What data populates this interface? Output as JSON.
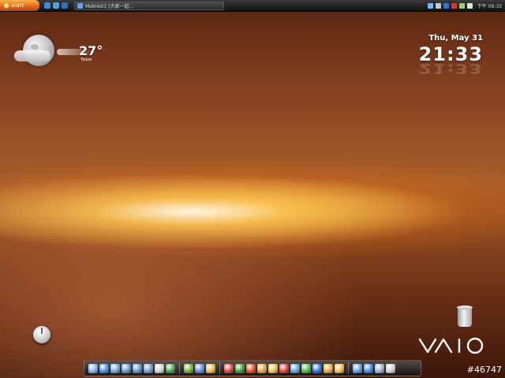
{
  "taskbar": {
    "start_label": "start",
    "task_window_title": "Mobile01 [大家一起...",
    "clock_time": "下午 09:33",
    "quicklaunch_icons": [
      {
        "name": "ie-icon",
        "color": "#3b8be0"
      },
      {
        "name": "show-desktop-icon",
        "color": "#4aa3df"
      },
      {
        "name": "media-icon",
        "color": "#2f6fc4"
      }
    ],
    "tray_icons": [
      {
        "name": "network-icon",
        "color": "#7fb3e6"
      },
      {
        "name": "volume-icon",
        "color": "#c9c9c9"
      },
      {
        "name": "bluetooth-icon",
        "color": "#2f70d6"
      },
      {
        "name": "security-icon",
        "color": "#d23a2a"
      },
      {
        "name": "battery-icon",
        "color": "#9ad06a"
      },
      {
        "name": "ime-icon",
        "color": "#e0e0e0"
      }
    ]
  },
  "weather": {
    "temperature": "27°",
    "city": "Taipei"
  },
  "clock": {
    "date": "Thu, May 31",
    "time": "21:33"
  },
  "dock": {
    "groups": [
      [
        {
          "name": "finder-icon",
          "color": "#7fb0e8"
        },
        {
          "name": "globe-icon",
          "color": "#3e8fd9"
        },
        {
          "name": "folder-icon",
          "color": "#6aa3d8"
        },
        {
          "name": "folder-docs-icon",
          "color": "#5b95cf"
        },
        {
          "name": "folder-music-icon",
          "color": "#5d8fc6"
        },
        {
          "name": "folder-pictures-icon",
          "color": "#6b9ad0"
        },
        {
          "name": "printer-icon",
          "color": "#cfcfcf"
        },
        {
          "name": "spreadsheet-icon",
          "color": "#3fa34d"
        }
      ],
      [
        {
          "name": "tools-icon",
          "color": "#6fae3a"
        },
        {
          "name": "control-panel-icon",
          "color": "#5b8ed6"
        },
        {
          "name": "explorer-icon",
          "color": "#e6b84a"
        }
      ],
      [
        {
          "name": "music-player-icon",
          "color": "#d9423a"
        },
        {
          "name": "video-cut-icon",
          "color": "#3b9b3b"
        },
        {
          "name": "media-center-icon",
          "color": "#e44b1f"
        },
        {
          "name": "vaio-media-icon",
          "color": "#d9a63b"
        },
        {
          "name": "dvd-icon",
          "color": "#e8c14a"
        },
        {
          "name": "messenger-icon",
          "color": "#e04030"
        },
        {
          "name": "equalizer-icon",
          "color": "#5aa0d8"
        },
        {
          "name": "chrome-icon",
          "color": "#4bb84a"
        },
        {
          "name": "bluetooth-icon",
          "color": "#2f6fd6"
        },
        {
          "name": "security-shield-icon",
          "color": "#e0a53b"
        },
        {
          "name": "game-icon",
          "color": "#f0b84a"
        }
      ],
      [
        {
          "name": "network-share-icon",
          "color": "#5d9fe0"
        },
        {
          "name": "internet-icon",
          "color": "#3f86d4"
        },
        {
          "name": "settings-icon",
          "color": "#9ab0c8"
        },
        {
          "name": "recycle-bin-icon",
          "color": "#cfcfcf"
        }
      ]
    ]
  },
  "watermark": "#46747",
  "brand": {
    "vaio_color": "#ffffff"
  }
}
